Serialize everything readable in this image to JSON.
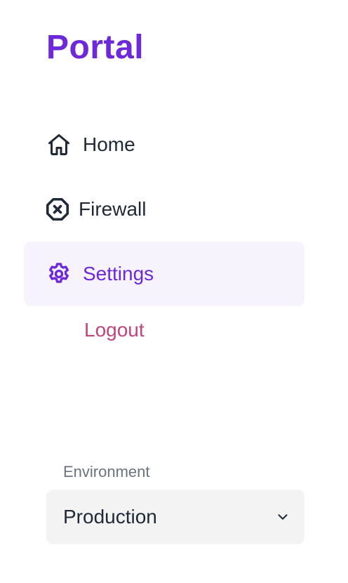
{
  "brand": {
    "name": "Portal",
    "color": "#6D28D9"
  },
  "colors": {
    "text": "#1F2937",
    "muted": "#6B7280",
    "active_bg": "#F6F3FD",
    "active_text": "#6D28D9",
    "logout": "#C0457E",
    "select_bg": "#F3F3F4"
  },
  "nav": {
    "items": [
      {
        "label": "Home",
        "icon": "home-icon",
        "active": false
      },
      {
        "label": "Firewall",
        "icon": "x-octagon-icon",
        "active": false
      },
      {
        "label": "Settings",
        "icon": "gear-icon",
        "active": true
      }
    ],
    "logout_label": "Logout"
  },
  "environment": {
    "label": "Environment",
    "selected": "Production",
    "icon": "chevron-down-icon"
  }
}
